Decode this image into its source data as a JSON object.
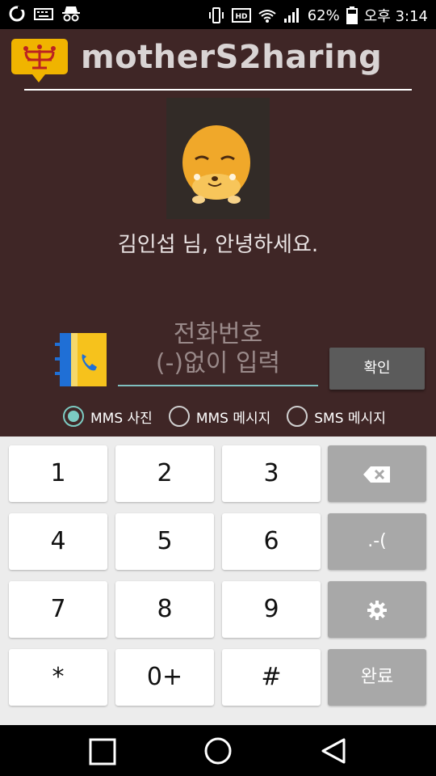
{
  "status_bar": {
    "battery_percent": "62%",
    "time": "오후 3:14",
    "icons": [
      "o-icon",
      "keyboard-icon",
      "incognito-icon",
      "vibrate-icon",
      "hd-icon",
      "wifi-icon",
      "signal-icon",
      "battery-icon"
    ]
  },
  "app": {
    "title": "motherS2haring",
    "greeting": "김인섭 님, 안녕하세요.",
    "phone_placeholder": "전화번호\n(-)없이 입력",
    "confirm_label": "확인",
    "options": [
      {
        "label": "MMS 사진",
        "checked": true
      },
      {
        "label": "MMS 메시지",
        "checked": false
      },
      {
        "label": "SMS 메시지",
        "checked": false
      }
    ],
    "colors": {
      "background": "#3f2626",
      "accent": "#7ccbc2",
      "logo": "#f0b400"
    }
  },
  "keyboard": {
    "keys": [
      "1",
      "2",
      "3",
      "4",
      "5",
      "6",
      "7",
      "8",
      "9",
      "*",
      "0+",
      "#"
    ],
    "side_keys": {
      "symbols": ".-(",
      "done": "완료"
    },
    "side_icons": [
      "backspace-icon",
      "settings-icon"
    ]
  },
  "nav_bar": {
    "icons": [
      "recents-icon",
      "home-icon",
      "back-icon"
    ]
  }
}
